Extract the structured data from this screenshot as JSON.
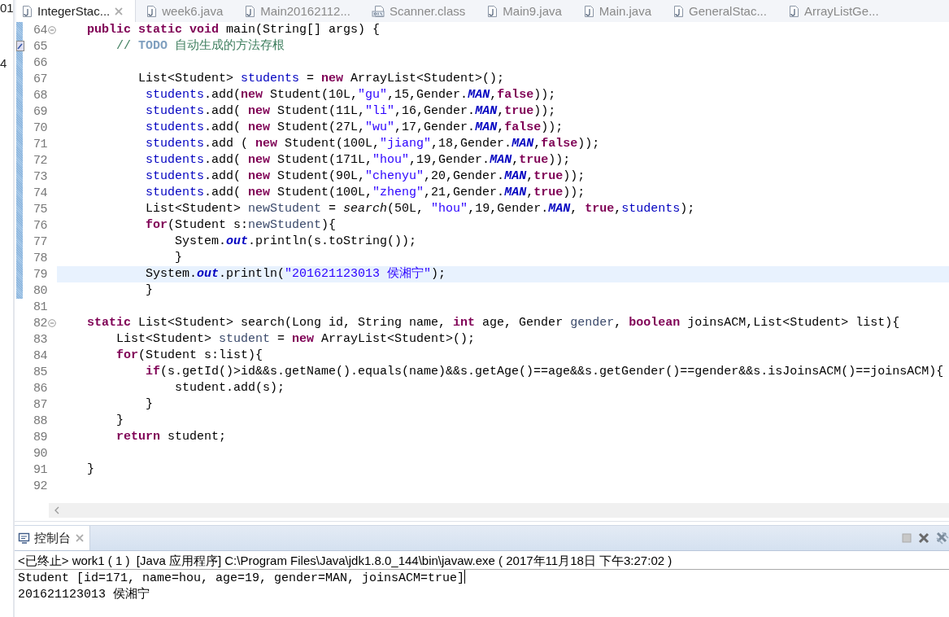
{
  "side_fragments": [
    "01",
    "4"
  ],
  "tabs": [
    {
      "label": "IntegerStac...",
      "kind": "java",
      "selected": true
    },
    {
      "label": "week6.java",
      "kind": "java",
      "selected": false
    },
    {
      "label": "Main20162112...",
      "kind": "java",
      "selected": false
    },
    {
      "label": "Scanner.class",
      "kind": "class",
      "selected": false
    },
    {
      "label": "Main9.java",
      "kind": "java",
      "selected": false
    },
    {
      "label": "Main.java",
      "kind": "java",
      "selected": false
    },
    {
      "label": "GeneralStac...",
      "kind": "java",
      "selected": false
    },
    {
      "label": "ArrayListGe...",
      "kind": "java",
      "selected": false
    }
  ],
  "editor": {
    "lines": [
      {
        "number": "64",
        "changed": true,
        "fold": true,
        "task": false,
        "current": false,
        "tokens": [
          {
            "kind": "kw",
            "text": "    public"
          },
          {
            "kind": "kw",
            "text": " static"
          },
          {
            "kind": "kw",
            "text": " void"
          },
          {
            "kind": "p",
            "text": " main(String[] args) {"
          }
        ]
      },
      {
        "number": "65",
        "changed": true,
        "fold": false,
        "task": true,
        "current": false,
        "tokens": [
          {
            "kind": "c",
            "text": "        // "
          },
          {
            "kind": "todo",
            "text": "TODO"
          },
          {
            "kind": "c",
            "text": " 自动生成的方法存根"
          }
        ]
      },
      {
        "number": "66",
        "changed": true,
        "fold": false,
        "task": false,
        "current": false
      },
      {
        "number": "67",
        "changed": true,
        "fold": false,
        "task": false,
        "current": false,
        "tokens": [
          {
            "kind": "p",
            "text": "           List<Student> "
          },
          {
            "kind": "f",
            "text": "students"
          },
          {
            "kind": "p",
            "text": " = "
          },
          {
            "kind": "kw",
            "text": "new"
          },
          {
            "kind": "p",
            "text": " ArrayList<Student>();"
          }
        ]
      },
      {
        "number": "68",
        "changed": true,
        "fold": false,
        "task": false,
        "current": false,
        "tokens": [
          {
            "kind": "f",
            "text": "            students"
          },
          {
            "kind": "p",
            "text": ".add("
          },
          {
            "kind": "kw",
            "text": "new"
          },
          {
            "kind": "p",
            "text": " Student(10L,"
          },
          {
            "kind": "s",
            "text": "\"gu\""
          },
          {
            "kind": "p",
            "text": ",15,Gender."
          },
          {
            "kind": "sf",
            "text": "MAN"
          },
          {
            "kind": "p",
            "text": ","
          },
          {
            "kind": "kw",
            "text": "false"
          },
          {
            "kind": "p",
            "text": "));"
          }
        ]
      },
      {
        "number": "69",
        "changed": true,
        "fold": false,
        "task": false,
        "current": false,
        "tokens": [
          {
            "kind": "f",
            "text": "            students"
          },
          {
            "kind": "p",
            "text": ".add( "
          },
          {
            "kind": "kw",
            "text": "new"
          },
          {
            "kind": "p",
            "text": " Student(11L,"
          },
          {
            "kind": "s",
            "text": "\"li\""
          },
          {
            "kind": "p",
            "text": ",16,Gender."
          },
          {
            "kind": "sf",
            "text": "MAN"
          },
          {
            "kind": "p",
            "text": ","
          },
          {
            "kind": "kw",
            "text": "true"
          },
          {
            "kind": "p",
            "text": "));"
          }
        ]
      },
      {
        "number": "70",
        "changed": true,
        "fold": false,
        "task": false,
        "current": false,
        "tokens": [
          {
            "kind": "f",
            "text": "            students"
          },
          {
            "kind": "p",
            "text": ".add( "
          },
          {
            "kind": "kw",
            "text": "new"
          },
          {
            "kind": "p",
            "text": " Student(27L,"
          },
          {
            "kind": "s",
            "text": "\"wu\""
          },
          {
            "kind": "p",
            "text": ",17,Gender."
          },
          {
            "kind": "sf",
            "text": "MAN"
          },
          {
            "kind": "p",
            "text": ","
          },
          {
            "kind": "kw",
            "text": "false"
          },
          {
            "kind": "p",
            "text": "));"
          }
        ]
      },
      {
        "number": "71",
        "changed": true,
        "fold": false,
        "task": false,
        "current": false,
        "tokens": [
          {
            "kind": "f",
            "text": "            students"
          },
          {
            "kind": "p",
            "text": ".add ( "
          },
          {
            "kind": "kw",
            "text": "new"
          },
          {
            "kind": "p",
            "text": " Student(100L,"
          },
          {
            "kind": "s",
            "text": "\"jiang\""
          },
          {
            "kind": "p",
            "text": ",18,Gender."
          },
          {
            "kind": "sf",
            "text": "MAN"
          },
          {
            "kind": "p",
            "text": ","
          },
          {
            "kind": "kw",
            "text": "false"
          },
          {
            "kind": "p",
            "text": "));"
          }
        ]
      },
      {
        "number": "72",
        "changed": true,
        "fold": false,
        "task": false,
        "current": false,
        "tokens": [
          {
            "kind": "f",
            "text": "            students"
          },
          {
            "kind": "p",
            "text": ".add( "
          },
          {
            "kind": "kw",
            "text": "new"
          },
          {
            "kind": "p",
            "text": " Student(171L,"
          },
          {
            "kind": "s",
            "text": "\"hou\""
          },
          {
            "kind": "p",
            "text": ",19,Gender."
          },
          {
            "kind": "sf",
            "text": "MAN"
          },
          {
            "kind": "p",
            "text": ","
          },
          {
            "kind": "kw",
            "text": "true"
          },
          {
            "kind": "p",
            "text": "));"
          }
        ]
      },
      {
        "number": "73",
        "changed": true,
        "fold": false,
        "task": false,
        "current": false,
        "tokens": [
          {
            "kind": "f",
            "text": "            students"
          },
          {
            "kind": "p",
            "text": ".add( "
          },
          {
            "kind": "kw",
            "text": "new"
          },
          {
            "kind": "p",
            "text": " Student(90L,"
          },
          {
            "kind": "s",
            "text": "\"chenyu\""
          },
          {
            "kind": "p",
            "text": ",20,Gender."
          },
          {
            "kind": "sf",
            "text": "MAN"
          },
          {
            "kind": "p",
            "text": ","
          },
          {
            "kind": "kw",
            "text": "true"
          },
          {
            "kind": "p",
            "text": "));"
          }
        ]
      },
      {
        "number": "74",
        "changed": true,
        "fold": false,
        "task": false,
        "current": false,
        "tokens": [
          {
            "kind": "f",
            "text": "            students"
          },
          {
            "kind": "p",
            "text": ".add( "
          },
          {
            "kind": "kw",
            "text": "new"
          },
          {
            "kind": "p",
            "text": " Student(100L,"
          },
          {
            "kind": "s",
            "text": "\"zheng\""
          },
          {
            "kind": "p",
            "text": ",21,Gender."
          },
          {
            "kind": "sf",
            "text": "MAN"
          },
          {
            "kind": "p",
            "text": ","
          },
          {
            "kind": "kw",
            "text": "true"
          },
          {
            "kind": "p",
            "text": "));"
          }
        ]
      },
      {
        "number": "75",
        "changed": true,
        "fold": false,
        "task": false,
        "current": false,
        "tokens": [
          {
            "kind": "p",
            "text": "            List<Student> "
          },
          {
            "kind": "v",
            "text": "newStudent"
          },
          {
            "kind": "p",
            "text": " = "
          },
          {
            "kind": "sm",
            "text": "search"
          },
          {
            "kind": "p",
            "text": "(50L, "
          },
          {
            "kind": "s",
            "text": "\"hou\""
          },
          {
            "kind": "p",
            "text": ",19,Gender."
          },
          {
            "kind": "sf",
            "text": "MAN"
          },
          {
            "kind": "p",
            "text": ", "
          },
          {
            "kind": "kw",
            "text": "true"
          },
          {
            "kind": "p",
            "text": ","
          },
          {
            "kind": "f",
            "text": "students"
          },
          {
            "kind": "p",
            "text": ");"
          }
        ]
      },
      {
        "number": "76",
        "changed": true,
        "fold": false,
        "task": false,
        "current": false,
        "tokens": [
          {
            "kind": "kw",
            "text": "            for"
          },
          {
            "kind": "p",
            "text": "(Student s:"
          },
          {
            "kind": "v",
            "text": "newStudent"
          },
          {
            "kind": "p",
            "text": "){"
          }
        ]
      },
      {
        "number": "77",
        "changed": true,
        "fold": false,
        "task": false,
        "current": false,
        "tokens": [
          {
            "kind": "p",
            "text": "                System."
          },
          {
            "kind": "sf",
            "text": "out"
          },
          {
            "kind": "p",
            "text": ".println(s.toString());"
          }
        ]
      },
      {
        "number": "78",
        "changed": true,
        "fold": false,
        "task": false,
        "current": false,
        "tokens": [
          {
            "kind": "p",
            "text": "                }"
          }
        ]
      },
      {
        "number": "79",
        "changed": true,
        "fold": false,
        "task": false,
        "current": true,
        "tokens": [
          {
            "kind": "p",
            "text": "            System."
          },
          {
            "kind": "sf",
            "text": "out"
          },
          {
            "kind": "p",
            "text": ".println("
          },
          {
            "kind": "s",
            "text": "\"201621123013 侯湘宁\""
          },
          {
            "kind": "p",
            "text": ");"
          }
        ]
      },
      {
        "number": "80",
        "changed": true,
        "fold": false,
        "task": false,
        "current": false,
        "tokens": [
          {
            "kind": "p",
            "text": "            }"
          }
        ]
      },
      {
        "number": "81",
        "changed": false,
        "fold": false,
        "task": false,
        "current": false
      },
      {
        "number": "82",
        "changed": false,
        "fold": true,
        "task": false,
        "current": false,
        "tokens": [
          {
            "kind": "kw",
            "text": "    static"
          },
          {
            "kind": "p",
            "text": " List<Student> search(Long id, String name, "
          },
          {
            "kind": "kw",
            "text": "int"
          },
          {
            "kind": "p",
            "text": " age, Gender "
          },
          {
            "kind": "v",
            "text": "gender"
          },
          {
            "kind": "p",
            "text": ", "
          },
          {
            "kind": "kw",
            "text": "boolean"
          },
          {
            "kind": "p",
            "text": " joinsACM,List<Student> list){"
          }
        ]
      },
      {
        "number": "83",
        "changed": false,
        "fold": false,
        "task": false,
        "current": false,
        "tokens": [
          {
            "kind": "p",
            "text": "        List<Student> "
          },
          {
            "kind": "v",
            "text": "student"
          },
          {
            "kind": "p",
            "text": " = "
          },
          {
            "kind": "kw",
            "text": "new"
          },
          {
            "kind": "p",
            "text": " ArrayList<Student>();"
          }
        ]
      },
      {
        "number": "84",
        "changed": false,
        "fold": false,
        "task": false,
        "current": false,
        "tokens": [
          {
            "kind": "kw",
            "text": "        for"
          },
          {
            "kind": "p",
            "text": "(Student s:list){"
          }
        ]
      },
      {
        "number": "85",
        "changed": false,
        "fold": false,
        "task": false,
        "current": false,
        "tokens": [
          {
            "kind": "kw",
            "text": "            if"
          },
          {
            "kind": "p",
            "text": "(s.getId()>id&&s.getName().equals(name)&&s.getAge()==age&&s.getGender()==gender&&s.isJoinsACM()==joinsACM){"
          }
        ]
      },
      {
        "number": "86",
        "changed": false,
        "fold": false,
        "task": false,
        "current": false,
        "tokens": [
          {
            "kind": "p",
            "text": "                student.add(s);"
          }
        ]
      },
      {
        "number": "87",
        "changed": false,
        "fold": false,
        "task": false,
        "current": false,
        "tokens": [
          {
            "kind": "p",
            "text": "            }"
          }
        ]
      },
      {
        "number": "88",
        "changed": false,
        "fold": false,
        "task": false,
        "current": false,
        "tokens": [
          {
            "kind": "p",
            "text": "        }"
          }
        ]
      },
      {
        "number": "89",
        "changed": false,
        "fold": false,
        "task": false,
        "current": false,
        "tokens": [
          {
            "kind": "kw",
            "text": "        return"
          },
          {
            "kind": "p",
            "text": " student;"
          }
        ]
      },
      {
        "number": "90",
        "changed": false,
        "fold": false,
        "task": false,
        "current": false
      },
      {
        "number": "91",
        "changed": false,
        "fold": false,
        "task": false,
        "current": false,
        "tokens": [
          {
            "kind": "p",
            "text": "    }"
          }
        ]
      },
      {
        "number": "92",
        "changed": false,
        "fold": false,
        "task": false,
        "current": false
      }
    ]
  },
  "console": {
    "tab": "控制台",
    "info": "<已终止> work1 ( 1 )  [Java 应用程序] C:\\Program Files\\Java\\jdk1.8.0_144\\bin\\javaw.exe ( 2017年11月18日 下午3:27:02 )",
    "output": [
      "Student [id=171, name=hou, age=19, gender=MAN, joinsACM=true]",
      "201621123013 侯湘宁"
    ]
  }
}
